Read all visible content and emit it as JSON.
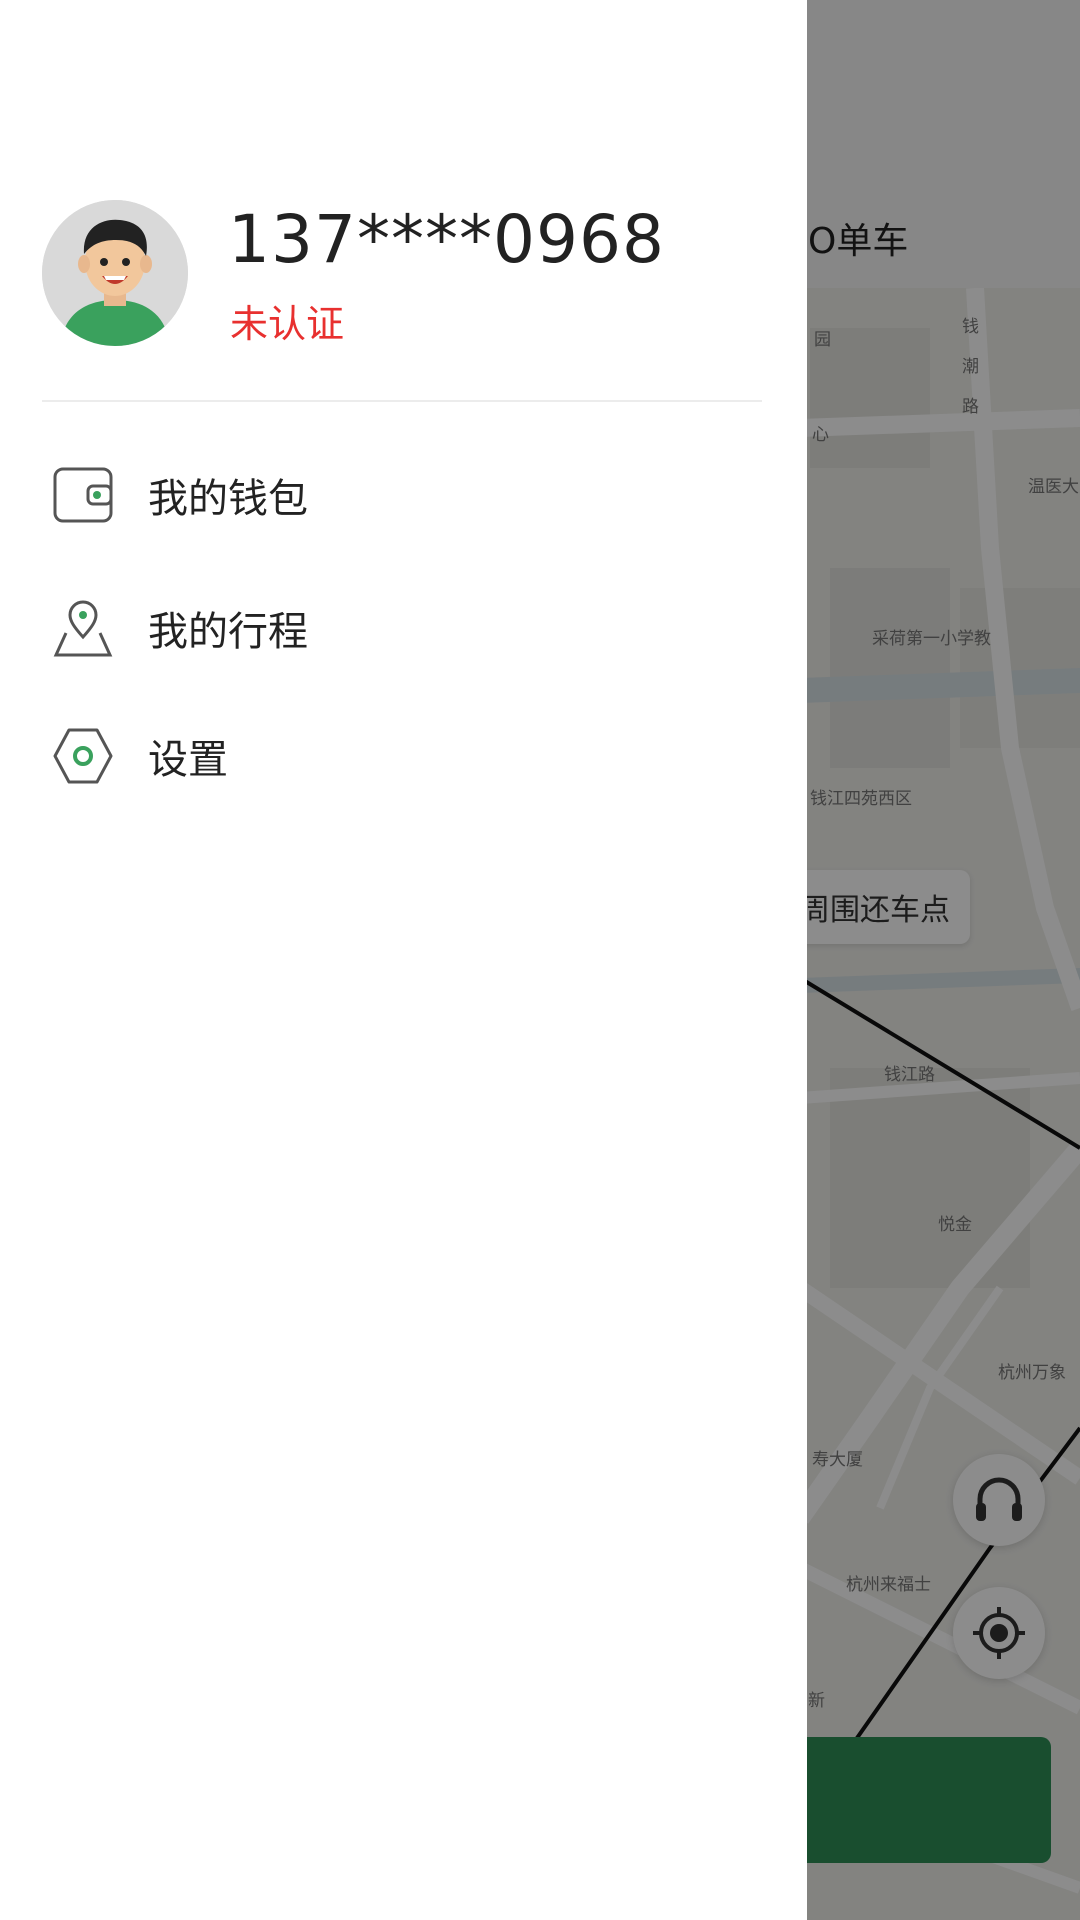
{
  "map": {
    "header_title": "O单车",
    "nearby_button_label": "周围还车点",
    "labels": {
      "l1": "园",
      "l2": "心",
      "l3": "钱",
      "l4": "潮",
      "l5": "路",
      "l6": "温医大",
      "l7": "采荷第一小学教",
      "l8": "钱江四苑西区",
      "l9": "钱江路",
      "l10": "悦金",
      "l11": "杭州万象",
      "l12": "寿大厦",
      "l13": "杭州来福士",
      "l14": "新"
    },
    "colors": {
      "primary_button": "#2f8f56"
    }
  },
  "drawer": {
    "avatar_icon": "user-avatar-icon",
    "phone": "137****0968",
    "verify_status": "未认证",
    "verify_color": "#e8302f",
    "menu": [
      {
        "label": "我的钱包",
        "icon": "wallet-icon"
      },
      {
        "label": "我的行程",
        "icon": "trip-location-icon"
      },
      {
        "label": "设置",
        "icon": "settings-gear-icon"
      }
    ],
    "accent_color": "#3aa15d"
  }
}
